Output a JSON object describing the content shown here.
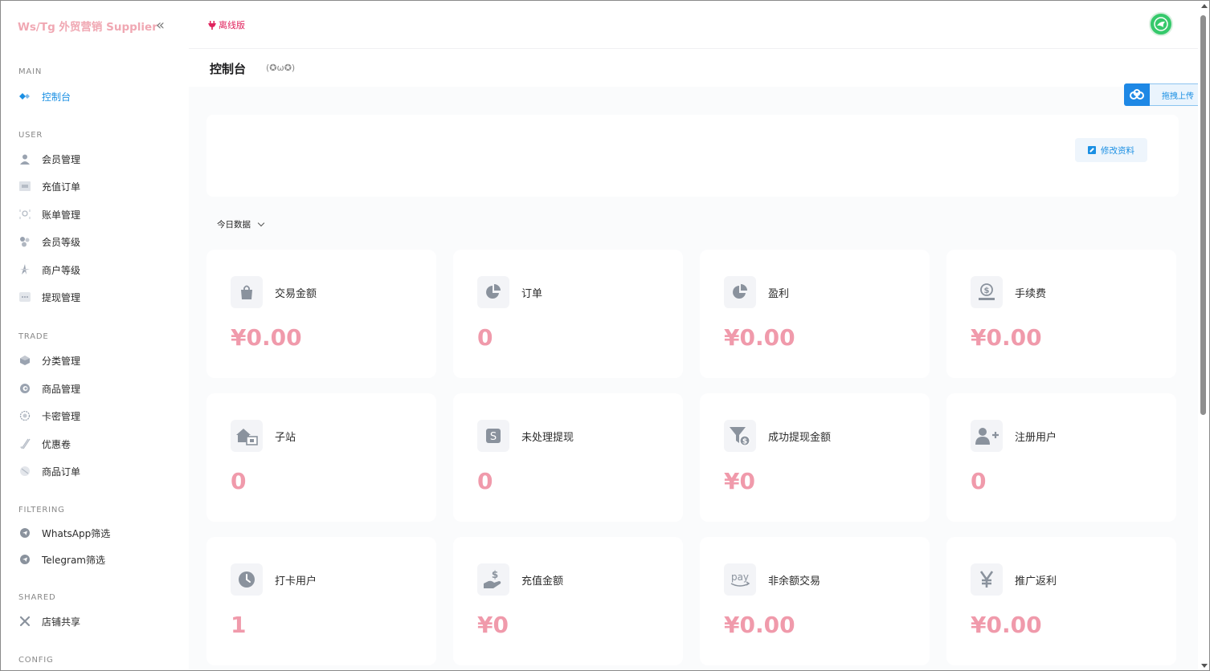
{
  "brand": {
    "title": "Ws/Tg 外贸营销 Supplier",
    "collapse_glyph": "«"
  },
  "sidebar": {
    "sections": [
      {
        "label": "MAIN",
        "items": [
          {
            "label": "控制台",
            "icon": "dashboard-icon",
            "active": true
          }
        ]
      },
      {
        "label": "USER",
        "items": [
          {
            "label": "会员管理",
            "icon": "user-icon"
          },
          {
            "label": "充值订单",
            "icon": "recharge-icon"
          },
          {
            "label": "账单管理",
            "icon": "bill-icon"
          },
          {
            "label": "会员等级",
            "icon": "level-icon"
          },
          {
            "label": "商户等级",
            "icon": "merchant-level-icon"
          },
          {
            "label": "提现管理",
            "icon": "withdraw-icon"
          }
        ]
      },
      {
        "label": "TRADE",
        "items": [
          {
            "label": "分类管理",
            "icon": "category-icon"
          },
          {
            "label": "商品管理",
            "icon": "goods-icon"
          },
          {
            "label": "卡密管理",
            "icon": "card-key-icon"
          },
          {
            "label": "优惠卷",
            "icon": "coupon-icon"
          },
          {
            "label": "商品订单",
            "icon": "order-icon"
          }
        ]
      },
      {
        "label": "FILTERING",
        "items": [
          {
            "label": "WhatsApp筛选",
            "icon": "send-icon"
          },
          {
            "label": "Telegram筛选",
            "icon": "send-icon"
          }
        ]
      },
      {
        "label": "SHARED",
        "items": [
          {
            "label": "店铺共享",
            "icon": "share-icon"
          }
        ]
      },
      {
        "label": "CONFIG",
        "items": []
      }
    ]
  },
  "topbar": {
    "offline_badge": "离线版"
  },
  "page": {
    "title": "控制台",
    "face": "(✪ω✪)"
  },
  "profile": {
    "edit_label": "修改资料"
  },
  "range": {
    "selected": "今日数据"
  },
  "upload": {
    "label": "拖拽上传"
  },
  "stats": [
    {
      "title": "交易金额",
      "value": "¥0.00",
      "icon": "shopping-bag-icon"
    },
    {
      "title": "订单",
      "value": "0",
      "icon": "pie-chart-icon"
    },
    {
      "title": "盈利",
      "value": "¥0.00",
      "icon": "pie-chart-icon"
    },
    {
      "title": "手续费",
      "value": "¥0.00",
      "icon": "dollar-hand-icon"
    },
    {
      "title": "子站",
      "value": "0",
      "icon": "house-user-icon"
    },
    {
      "title": "未处理提现",
      "value": "0",
      "icon": "money-icon"
    },
    {
      "title": "成功提现金额",
      "value": "¥0",
      "icon": "funnel-dollar-icon"
    },
    {
      "title": "注册用户",
      "value": "0",
      "icon": "user-plus-icon"
    },
    {
      "title": "打卡用户",
      "value": "1",
      "icon": "clock-icon"
    },
    {
      "title": "充值金额",
      "value": "¥0",
      "icon": "hand-dollar-icon"
    },
    {
      "title": "非余额交易",
      "value": "¥0.00",
      "icon": "pay-icon"
    },
    {
      "title": "推广返利",
      "value": "¥0.00",
      "icon": "yen-icon"
    }
  ],
  "colors": {
    "brand": "#f0a8b3",
    "accent": "#1a8fe3",
    "value": "#f09aab",
    "offline": "#e0245e"
  }
}
